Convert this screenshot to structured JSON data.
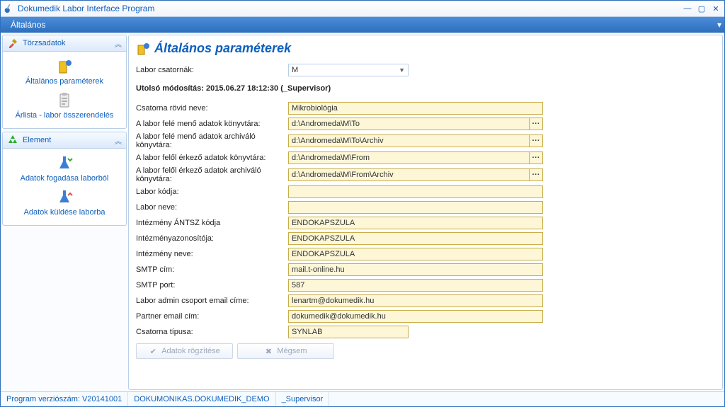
{
  "window": {
    "title": "Dokumedik Labor Interface Program"
  },
  "menubar": {
    "items": [
      "Általános"
    ]
  },
  "sidebar": {
    "groups": [
      {
        "title": "Törzsadatok",
        "items": [
          {
            "label": "Általános paraméterek"
          },
          {
            "label": "Árlista - labor összerendelés"
          }
        ]
      },
      {
        "title": "Element",
        "items": [
          {
            "label": "Adatok fogadása laborból"
          },
          {
            "label": "Adatok küldése laborba"
          }
        ]
      }
    ]
  },
  "page": {
    "title": "Általános paraméterek",
    "channel_label": "Labor csatornák:",
    "channel_value": "M",
    "last_modified": "Utolsó módosítás: 2015.06.27 18:12:30 (_Supervisor)",
    "fields": {
      "short_name": {
        "label": "Csatorna rövid neve:",
        "value": "Mikrobiológia"
      },
      "to_dir": {
        "label": "A labor felé menő adatok könyvtára:",
        "value": "d:\\Andromeda\\M\\To"
      },
      "to_archive_dir": {
        "label": "A labor felé menő adatok archiváló könyvtára:",
        "value": "d:\\Andromeda\\M\\To\\Archiv"
      },
      "from_dir": {
        "label": "A labor felől érkező adatok könyvtára:",
        "value": "d:\\Andromeda\\M\\From"
      },
      "from_archive_dir": {
        "label": "A labor felől érkező adatok archiváló könyvtára:",
        "value": "d:\\Andromeda\\M\\From\\Archiv"
      },
      "lab_code": {
        "label": "Labor kódja:",
        "value": ""
      },
      "lab_name": {
        "label": "Labor neve:",
        "value": ""
      },
      "antsz": {
        "label": "Intézmény ÁNTSZ kódja",
        "value": "ENDOKAPSZULA"
      },
      "inst_id": {
        "label": "Intézményazonosítója:",
        "value": "ENDOKAPSZULA"
      },
      "inst_name": {
        "label": "Intézmény neve:",
        "value": "ENDOKAPSZULA"
      },
      "smtp_host": {
        "label": "SMTP cím:",
        "value": "mail.t-online.hu"
      },
      "smtp_port": {
        "label": "SMTP port:",
        "value": "587"
      },
      "admin_email": {
        "label": "Labor admin csoport email címe:",
        "value": "lenartm@dokumedik.hu"
      },
      "partner_email": {
        "label": "Partner email cím:",
        "value": "dokumedik@dokumedik.hu"
      },
      "channel_type": {
        "label": "Csatorna típusa:",
        "value": "SYNLAB"
      }
    },
    "buttons": {
      "save": "Adatok rögzítése",
      "cancel": "Mégsem"
    }
  },
  "statusbar": {
    "version": "Program verziószám: V20141001",
    "db": "DOKUMONIKAS.DOKUMEDIK_DEMO",
    "user": "_Supervisor"
  },
  "colors": {
    "accent": "#0d5fbd",
    "field_bg": "#fdf7d8",
    "field_border": "#c9ad4a"
  }
}
